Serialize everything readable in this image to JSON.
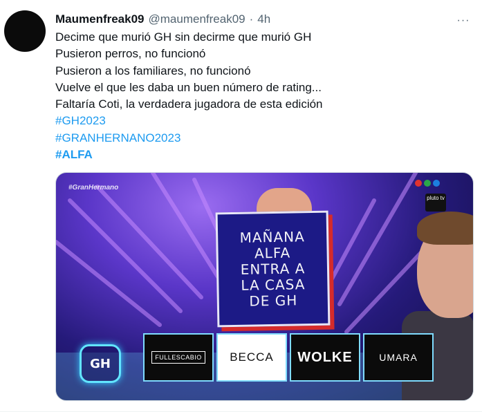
{
  "tweet": {
    "display_name": "Maumenfreak09",
    "handle": "@maumenfreak09",
    "separator": "·",
    "time": "4h",
    "more_label": "···",
    "lines": [
      "Decime que murió GH sin decirme que murió GH",
      "Pusieron perros, no funcionó",
      "Pusieron a los familiares, no funcionó",
      "Vuelve el que les daba un buen número de rating...",
      "Faltaría Coti, la verdadera jugadora de esta edición"
    ],
    "hashtags": [
      "#GH2023",
      "#GRANHERNANO2023",
      "#ALFA"
    ]
  },
  "media": {
    "show_tag": "#GranHermano",
    "network_colors": [
      "#e0332f",
      "#2aa84a",
      "#1c7fe0"
    ],
    "pluto_label": "pluto tv",
    "sign_lines": [
      "MAÑANA",
      "ALFA",
      "ENTRA A",
      "LA CASA",
      "DE GH"
    ],
    "gh_logo": "GH",
    "sponsors": [
      "FULLESCABIO",
      "BECCA",
      "WOLKE",
      "UMARA"
    ]
  }
}
